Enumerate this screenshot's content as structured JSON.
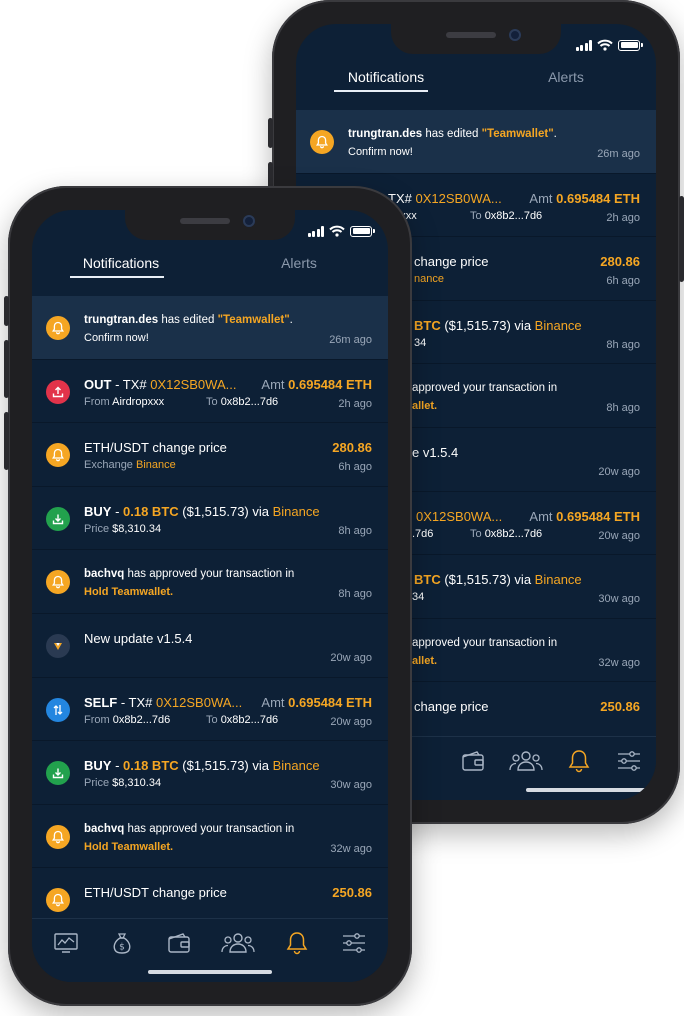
{
  "back_phone": {
    "tabs": [
      {
        "label": "Notifications"
      },
      {
        "label": "Alerts"
      }
    ],
    "items": [
      {
        "pre_bold": "trungtran.des",
        "text": " has edited ",
        "quoted": "\"Teamwallet\"",
        "post": ".",
        "line2": "Confirm now!",
        "time": "26m ago"
      },
      {
        "left_top": "TX# ",
        "left_top_or": "0X12SB0WA...",
        "amt_label": "Amt ",
        "amt_val": "0.695484 ETH",
        "sub_left": "opxxx",
        "to_label": "To ",
        "to_val": "0x8b2...7d6",
        "time": "2h ago"
      },
      {
        "title": "change price",
        "sub_or": "nance",
        "value": "280.86",
        "time": "6h ago"
      },
      {
        "title_or": "BTC",
        "title": " ($1,515.73) via ",
        "title_or2": "Binance",
        "sub": "34",
        "time": "8h ago"
      },
      {
        "title": "approved your transaction in",
        "sub_or": "allet.",
        "time": "8h ago"
      },
      {
        "title": "e v1.5.4",
        "time": "20w ago"
      },
      {
        "left_top_or": "0X12SB0WA...",
        "amt_label": "Amt ",
        "amt_val": "0.695484 ETH",
        "sub_left": ".7d6",
        "to_label": "To ",
        "to_val": "0x8b2...7d6",
        "time": "20w ago"
      },
      {
        "title_or": "BTC",
        "title": " ($1,515.73) via ",
        "title_or2": "Binance",
        "sub": "34",
        "time": "30w ago"
      },
      {
        "title": "approved your transaction in",
        "sub_or": "allet.",
        "time": "32w ago"
      },
      {
        "title": "change price",
        "value": "250.86"
      }
    ]
  },
  "front_phone": {
    "tabs": [
      {
        "label": "Notifications"
      },
      {
        "label": "Alerts"
      }
    ],
    "items": [
      {
        "pre_bold": "trungtran.des",
        "text": " has edited ",
        "quoted": "\"Teamwallet\"",
        "post": ".",
        "line2": "Confirm now!",
        "time": "26m ago"
      },
      {
        "kind": "OUT",
        "sep": " - TX# ",
        "tx": "0X12SB0WA...",
        "amt_label": "Amt ",
        "amt_val": "0.695484 ETH",
        "from_label": "From ",
        "from_val": "Airdropxxx",
        "to_label": "To ",
        "to_val": "0x8b2...7d6",
        "time": "2h ago"
      },
      {
        "title": "ETH/USDT change price",
        "sub_label": "Exchange ",
        "sub_or": "Binance",
        "value": "280.86",
        "time": "6h ago"
      },
      {
        "kind": "BUY",
        "sep": " - ",
        "amount": "0.18 BTC",
        "title": " ($1,515.73) via ",
        "title_or2": "Binance",
        "sub_label": "Price ",
        "sub_val": "$8,310.34",
        "time": "8h ago"
      },
      {
        "pre_bold": "bachvq",
        "text": " has approved your transaction in",
        "line2": "Hold Teamwallet.",
        "time": "8h ago"
      },
      {
        "title": "New update v1.5.4",
        "time": "20w ago"
      },
      {
        "kind": "SELF",
        "sep": " - TX# ",
        "tx": "0X12SB0WA...",
        "amt_label": "Amt ",
        "amt_val": "0.695484 ETH",
        "from_label": "From ",
        "from_val": "0x8b2...7d6",
        "to_label": "To ",
        "to_val": "0x8b2...7d6",
        "time": "20w ago"
      },
      {
        "kind": "BUY",
        "sep": " - ",
        "amount": "0.18 BTC",
        "title": " ($1,515.73) via ",
        "title_or2": "Binance",
        "sub_label": "Price ",
        "sub_val": "$8,310.34",
        "time": "30w ago"
      },
      {
        "pre_bold": "bachvq",
        "text": " has approved your transaction in",
        "line2": "Hold Teamwallet.",
        "time": "32w ago"
      },
      {
        "title": "ETH/USDT change price",
        "value": "250.86"
      }
    ]
  },
  "icons": {
    "bell": "bell-icon",
    "upload": "upload-icon",
    "download": "download-icon",
    "swap": "swap-icon",
    "logo": "app-logo-icon",
    "nav": [
      "chart-icon",
      "money-bag-icon",
      "wallet-icon",
      "team-icon",
      "bell-icon",
      "settings-sliders-icon"
    ]
  },
  "colors": {
    "background": "#0d2036",
    "highlight": "#1a3049",
    "accent": "#f5a623",
    "muted": "#9aa7b8",
    "out": "#e2334a",
    "buy": "#22a14d",
    "self": "#2386e0"
  }
}
